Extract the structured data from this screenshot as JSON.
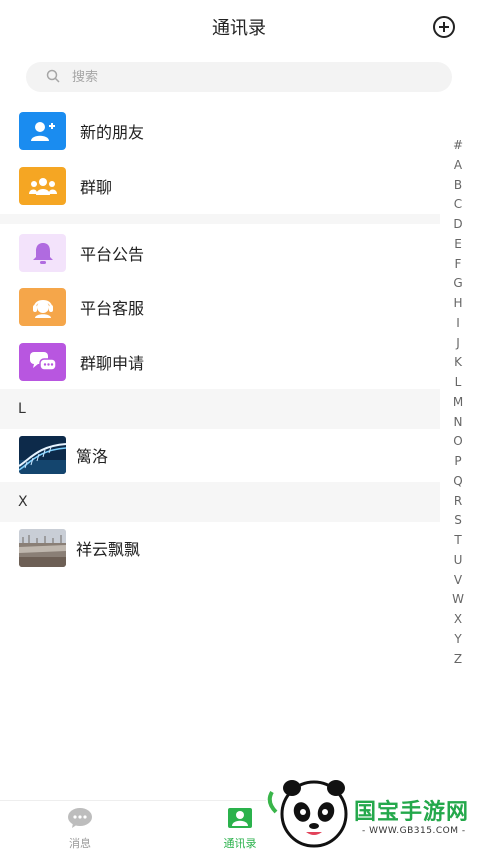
{
  "header": {
    "title": "通讯录"
  },
  "search": {
    "placeholder": "搜索"
  },
  "function_items": [
    {
      "label": "新的朋友",
      "icon": "new-friend-icon",
      "color": "#1a8cf0"
    },
    {
      "label": "群聊",
      "icon": "group-chat-icon",
      "color": "#f5a623"
    }
  ],
  "service_items": [
    {
      "label": "平台公告",
      "icon": "bell-icon",
      "color": "#b06be0"
    },
    {
      "label": "平台客服",
      "icon": "customer-service-icon",
      "color": "#f5a64a"
    },
    {
      "label": "群聊申请",
      "icon": "chat-bubbles-icon",
      "color": "#b856e0"
    }
  ],
  "sections": [
    {
      "letter": "L",
      "contacts": [
        {
          "name": "篱洛"
        }
      ]
    },
    {
      "letter": "X",
      "contacts": [
        {
          "name": "祥云飘飘"
        }
      ]
    }
  ],
  "index_letters": [
    "#",
    "A",
    "B",
    "C",
    "D",
    "E",
    "F",
    "G",
    "H",
    "I",
    "J",
    "K",
    "L",
    "M",
    "N",
    "O",
    "P",
    "Q",
    "R",
    "S",
    "T",
    "U",
    "V",
    "W",
    "X",
    "Y",
    "Z"
  ],
  "tabbar": {
    "messages_label": "消息",
    "contacts_label": "通讯录",
    "active_color": "#2bb24c"
  },
  "watermark": {
    "brand": "国宝手游网",
    "url": "- WWW.GB315.COM -"
  }
}
